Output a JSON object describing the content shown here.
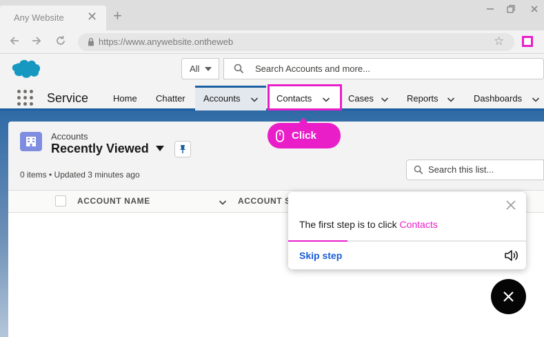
{
  "browser": {
    "tab_title": "Any Website",
    "tab_close": "✕",
    "new_tab": "+",
    "url": "https://www.anywebsite.ontheweb"
  },
  "header": {
    "search_scope": "All",
    "search_placeholder": "Search Accounts and more..."
  },
  "nav": {
    "app_name": "Service",
    "items": [
      {
        "label": "Home"
      },
      {
        "label": "Chatter"
      },
      {
        "label": "Accounts"
      },
      {
        "label": "Contacts"
      },
      {
        "label": "Cases"
      },
      {
        "label": "Reports"
      },
      {
        "label": "Dashboards"
      }
    ]
  },
  "list_view": {
    "object_label": "Accounts",
    "title": "Recently Viewed",
    "status": "0 items • Updated 3 minutes ago",
    "search_placeholder": "Search this list...",
    "columns": [
      "ACCOUNT NAME",
      "ACCOUNT S"
    ]
  },
  "tooltip": {
    "label": "Click"
  },
  "step_panel": {
    "text_prefix": "The first step is to click ",
    "text_highlight": "Contacts",
    "skip_label": "Skip step",
    "progress": 0.25
  },
  "colors": {
    "accent": "#e91ec9",
    "link": "#1a5bd6",
    "nav_active": "#1b5fa0"
  },
  "icons": {
    "close": "close-icon",
    "speaker": "speaker-icon",
    "mouse": "mouse-icon"
  }
}
